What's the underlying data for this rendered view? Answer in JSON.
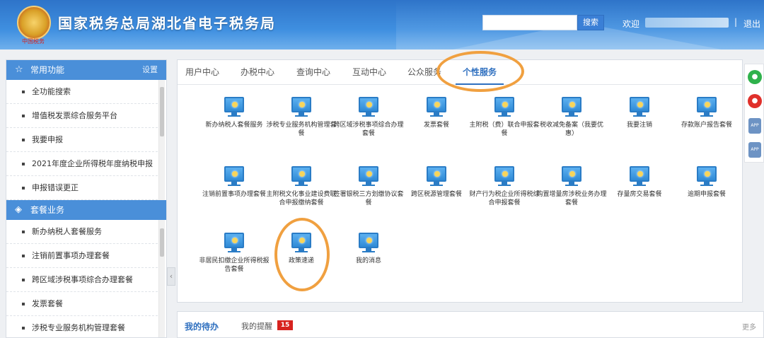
{
  "header": {
    "emblem_text": "中国税务",
    "site_title": "国家税务总局湖北省电子税务局",
    "search_value": "",
    "search_button": "搜索",
    "welcome": "欢迎",
    "separator": "|",
    "logout": "退出"
  },
  "sidebar": {
    "common": {
      "title": "常用功能",
      "setting": "设置",
      "items": [
        {
          "label": "全功能搜索"
        },
        {
          "label": "增值税发票综合服务平台"
        },
        {
          "label": "我要申报"
        },
        {
          "label": "2021年度企业所得税年度纳税申报"
        },
        {
          "label": "申报错误更正"
        }
      ]
    },
    "package": {
      "title": "套餐业务",
      "items": [
        {
          "label": "新办纳税人套餐服务"
        },
        {
          "label": "注销前置事项办理套餐"
        },
        {
          "label": "跨区域涉税事项综合办理套餐"
        },
        {
          "label": "发票套餐"
        },
        {
          "label": "涉税专业服务机构管理套餐"
        }
      ]
    }
  },
  "tabs": [
    {
      "label": "用户中心"
    },
    {
      "label": "办税中心"
    },
    {
      "label": "查询中心"
    },
    {
      "label": "互动中心"
    },
    {
      "label": "公众服务"
    },
    {
      "label": "个性服务"
    }
  ],
  "active_tab": "个性服务",
  "tiles": [
    {
      "label": "新办纳税人套餐服务"
    },
    {
      "label": "涉税专业服务机构管理套餐"
    },
    {
      "label": "跨区域涉税事项综合办理套餐"
    },
    {
      "label": "发票套餐"
    },
    {
      "label": "主附税（费）联合申报套餐"
    },
    {
      "label": "税收减免备案（我要优惠）"
    },
    {
      "label": "我要注销"
    },
    {
      "label": "存款账户报告套餐"
    },
    {
      "label": "注销前置事项办理套餐"
    },
    {
      "label": "主附税文化事业建设费联合申报缴纳套餐"
    },
    {
      "label": "签署银税三方划缴协议套餐"
    },
    {
      "label": "跨区税源管理套餐"
    },
    {
      "label": "财产行为税企业所得税综合申报套餐"
    },
    {
      "label": "购置增量房涉税业务办理套餐"
    },
    {
      "label": "存量房交易套餐"
    },
    {
      "label": "逾期申报套餐"
    },
    {
      "label": "非居民扣缴企业所得税报告套餐"
    },
    {
      "label": "政策速递"
    },
    {
      "label": "我的消息"
    }
  ],
  "bottom": {
    "todo": "我的待办",
    "remind": "我的提醒",
    "remind_count": "15",
    "more": "更多"
  },
  "float_bar": {
    "app1": "APP",
    "app2": "APP"
  },
  "colors": {
    "header_blue": "#3f8fe0",
    "section_blue": "#4a8fd9",
    "active_tab": "#2e6fbf",
    "annotation_orange": "#f0a040",
    "badge_red": "#d7231f"
  }
}
